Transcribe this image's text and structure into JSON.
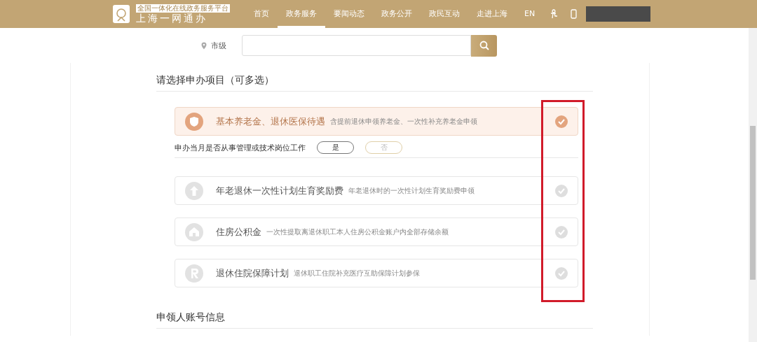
{
  "header": {
    "logo_tagline": "全国一体化在线政务服务平台",
    "logo_title": "上海一网通办",
    "nav": [
      {
        "label": "首页",
        "selected": false
      },
      {
        "label": "政务服务",
        "selected": true
      },
      {
        "label": "要闻动态",
        "selected": false
      },
      {
        "label": "政务公开",
        "selected": false
      },
      {
        "label": "政民互动",
        "selected": false
      },
      {
        "label": "走进上海",
        "selected": false
      },
      {
        "label": "EN",
        "selected": false
      }
    ]
  },
  "search": {
    "location": "市级"
  },
  "section_title": "请选择申办项目（可多选）",
  "items": [
    {
      "title": "基本养老金、退休医保待遇",
      "desc": "含提前退休申领养老金、一次性补充养老金申领",
      "selected": true,
      "question": {
        "text": "申办当月是否从事管理或技术岗位工作",
        "options": [
          {
            "label": "是",
            "selected": true
          },
          {
            "label": "否",
            "selected": false
          }
        ]
      }
    },
    {
      "title": "年老退休一次性计划生育奖励费",
      "desc": "年老退休时的一次性计划生育奖励费申领",
      "selected": false
    },
    {
      "title": "住房公积金",
      "desc": "一次性提取离退休职工本人住房公积金账户内全部存储余额",
      "selected": false
    },
    {
      "title": "退休住院保障计划",
      "desc": "退休职工住院补充医疗互助保障计划参保",
      "selected": false
    }
  ],
  "section2_title": "申领人账号信息"
}
